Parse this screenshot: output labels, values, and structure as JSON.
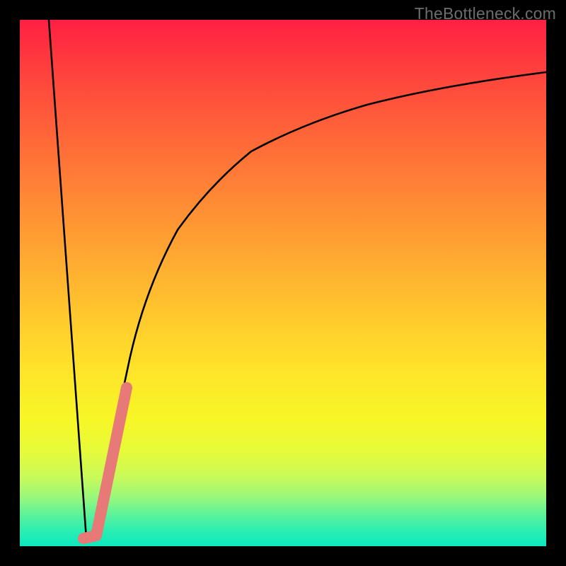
{
  "watermark": {
    "text": "TheBottleneck.com"
  },
  "chart_data": {
    "type": "line",
    "title": "",
    "xlabel": "",
    "ylabel": "",
    "xlim": [
      0,
      100
    ],
    "ylim": [
      0,
      100
    ],
    "series": [
      {
        "name": "left-leg",
        "x": [
          5.5,
          12.6
        ],
        "values": [
          100,
          1.5
        ]
      },
      {
        "name": "right-curve",
        "x": [
          14.5,
          16,
          18,
          21,
          25,
          30,
          36,
          44,
          54,
          66,
          80,
          90,
          100
        ],
        "values": [
          2,
          10,
          22,
          36,
          49,
          60,
          68.5,
          75,
          80.2,
          84,
          87,
          88.6,
          90
        ]
      }
    ],
    "marker": {
      "name": "pink-segment",
      "color": "#e77a76",
      "x": [
        12.6,
        14.5,
        20.2
      ],
      "values": [
        1.5,
        2,
        30
      ]
    }
  }
}
